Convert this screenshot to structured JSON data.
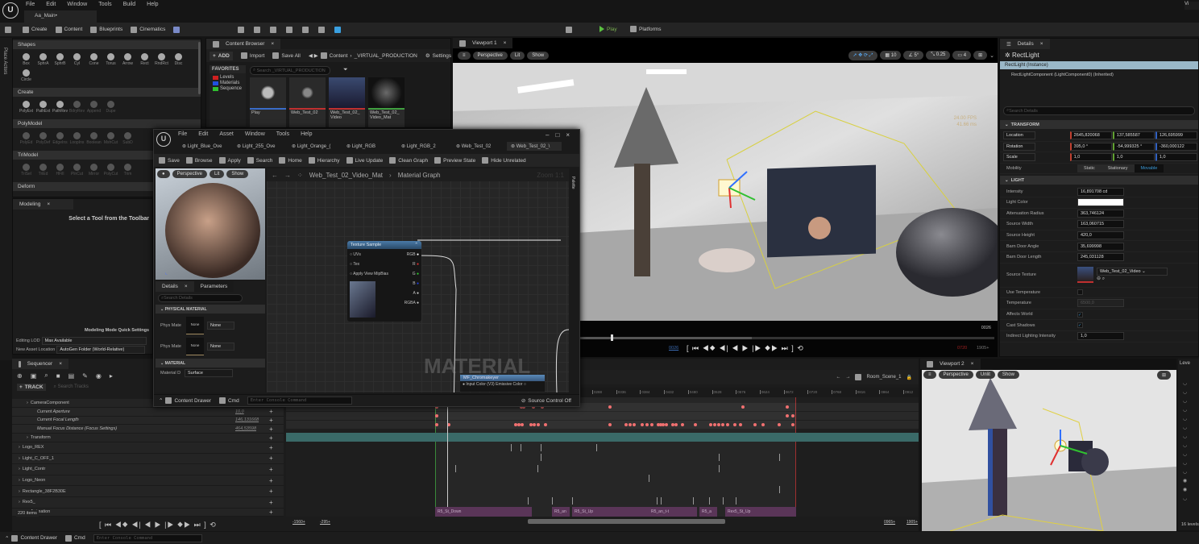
{
  "app": {
    "menu": [
      "File",
      "Edit",
      "Window",
      "Tools",
      "Build",
      "Help"
    ],
    "level_tab": "Aa_Main•",
    "top_right": "Vi"
  },
  "toolbar": {
    "create": "Create",
    "content": "Content",
    "blueprints": "Blueprints",
    "cinematics": "Cinematics",
    "play": "Play",
    "platforms": "Platforms"
  },
  "place_actors": {
    "side_label": "Place Actors",
    "sections": [
      {
        "title": "Shapes",
        "items": [
          "Box",
          "SphrA",
          "SphrB",
          "Cyl",
          "Cone",
          "Torus",
          "Arrow",
          "Rect",
          "RndRct",
          "Disc",
          "Circle"
        ]
      },
      {
        "title": "Create",
        "items": [
          "PolyExt",
          "PathExt",
          "PathRev",
          "BdryRev",
          "Append",
          "Dupe"
        ]
      },
      {
        "title": "PolyModel",
        "items": [
          "PolyEd",
          "PolyDef",
          "EdgeIns",
          "LoopIns",
          "Boolean",
          "MshCut",
          "SubD"
        ]
      },
      {
        "title": "TriModel",
        "items": [
          "TriSel",
          "TriEd",
          "HFill",
          "PlnCut",
          "Mirror",
          "PolyCut",
          "Trim"
        ]
      },
      {
        "title": "Deform",
        "items": []
      }
    ]
  },
  "modeling": {
    "tab": "Modeling",
    "hint": "Select a Tool from the Toolbar",
    "quick_settings": "Modeling Mode Quick Settings",
    "editing_lod_label": "Editing LOD",
    "editing_lod_value": "Max Available",
    "asset_loc_label": "New Asset Location",
    "asset_loc_value": "AutoGen Folder (World-Relative)"
  },
  "content_browser": {
    "tab": "Content Browser",
    "add": "ADD",
    "import": "Import",
    "save_all": "Save All",
    "path": [
      "Content",
      "_VIRTUAL_PRODUCTION"
    ],
    "settings": "Settings",
    "favorites": "FAVORITES",
    "search_placeholder": "Search _VIRTUAL_PRODUCTION",
    "folders": [
      {
        "name": "Levels",
        "color": "#d02020"
      },
      {
        "name": "Materials",
        "color": "#2050e0"
      },
      {
        "name": "Sequence",
        "color": "#30c030"
      }
    ],
    "assets": [
      {
        "name": "Play",
        "bar": "#3a6cc8"
      },
      {
        "name": "Web_Test_02",
        "bar": "#c03030"
      },
      {
        "name": "Web_Test_02_ Video",
        "bar": "#c03030"
      },
      {
        "name": "Web_Test_02_ Video_Mat",
        "bar": "#40a040"
      }
    ]
  },
  "material_editor": {
    "menu": [
      "File",
      "Edit",
      "Asset",
      "Window",
      "Tools",
      "Help"
    ],
    "tabs": [
      "Light_Blue_Ove",
      "Light_255_Ove",
      "Light_Orange_(",
      "Light_RGB",
      "Light_RGB_2",
      "Web_Test_02",
      "Web_Test_02_\\"
    ],
    "toolbar": [
      "Save",
      "Browse",
      "Apply",
      "Search",
      "Home",
      "Hierarchy",
      "Live Update",
      "Clean Graph",
      "Preview State",
      "Hide Unrelated"
    ],
    "preview": {
      "perspective": "Perspective",
      "lit": "Lit",
      "show": "Show"
    },
    "breadcrumb": [
      "Web_Test_02_Video_Mat",
      "Material Graph"
    ],
    "zoom": "Zoom 1:1",
    "palette": "Palette",
    "details_tab": "Details",
    "parameters_tab": "Parameters",
    "search_placeholder": "Search Details",
    "physical_material": "PHYSICAL MATERIAL",
    "phys_rows": [
      {
        "label": "Phys Mate",
        "thumb": "None",
        "value": "None"
      },
      {
        "label": "Phys Mate",
        "thumb": "None",
        "value": "None"
      }
    ],
    "material_section": "MATERIAL",
    "material_domain_label": "Material D",
    "material_domain_value": "Surface",
    "node": {
      "title": "Texture Sample",
      "inputs": [
        "UVs",
        "Tex",
        "Apply View MipBias"
      ],
      "outputs": [
        {
          "name": "RGB",
          "color": "#ffffff"
        },
        {
          "name": "R",
          "color": "#e03030"
        },
        {
          "name": "G",
          "color": "#30d030"
        },
        {
          "name": "B",
          "color": "#2040e0"
        },
        {
          "name": "A",
          "color": "#cccccc"
        },
        {
          "name": "RGBA",
          "color": "#cccccc"
        }
      ]
    },
    "node2": {
      "title": "MF_Chromakeyer",
      "input": "Input Color (V3)",
      "output": "Emissive Color"
    },
    "watermark": "MATERIAL",
    "content_drawer": "Content Drawer",
    "cmd": "Cmd",
    "console_placeholder": "Enter Console Command",
    "source_control": "Source Control Off"
  },
  "viewport1": {
    "tab": "Viewport 1",
    "perspective": "Perspective",
    "lit": "Lit",
    "show": "Show",
    "grid": "10",
    "angle": "5°",
    "scale": "0.25",
    "camera_speed": "4",
    "fps": "24.00 FPS",
    "ms": "41.66 ms",
    "frame_right": "0026",
    "frame_current": "0026",
    "frame_end": "0720",
    "frame_max": "1905+",
    "playhead_fraction": 0.29,
    "range_fraction": 0.55
  },
  "details": {
    "tab": "Details",
    "actor": "RectLight",
    "instance": "RectLight  (Instance)",
    "component": "RectLightComponent (LightComponent0) (Inherited)",
    "search_placeholder": "Search Details",
    "transform": "TRANSFORM",
    "location": {
      "label": "Location",
      "x": "2645,820068",
      "y": "137,585587",
      "z": "126,695999"
    },
    "rotation": {
      "label": "Rotation",
      "x": "395,0 °",
      "y": "-54,999325 °",
      "z": "-360,000122"
    },
    "scale": {
      "label": "Scale",
      "x": "1,0",
      "y": "1,0",
      "z": "1,0"
    },
    "mobility": {
      "label": "Mobility",
      "options": [
        "Static",
        "Stationary",
        "Movable"
      ],
      "selected": "Movable"
    },
    "light": "LIGHT",
    "props": [
      {
        "label": "Intensity",
        "value": "16,891708 cd"
      },
      {
        "label": "Light Color",
        "value": ""
      },
      {
        "label": "Attenuation Radius",
        "value": "363,746124"
      },
      {
        "label": "Source Width",
        "value": "163,060715"
      },
      {
        "label": "Source Height",
        "value": "420,0"
      },
      {
        "label": "Barn Door Angle",
        "value": "35,699998"
      },
      {
        "label": "Barn Door Length",
        "value": "245,031128"
      }
    ],
    "source_texture_label": "Source Texture",
    "source_texture_value": "Web_Test_02_Video",
    "checks": [
      {
        "label": "Use Temperature",
        "checked": false
      },
      {
        "label": "Temperature",
        "value": "6500,0"
      },
      {
        "label": "Affects World",
        "checked": true
      },
      {
        "label": "Cast Shadows",
        "checked": true
      },
      {
        "label": "Indirect Lighting Intensity",
        "value": "1,0"
      }
    ]
  },
  "sequencer": {
    "tab": "Sequencer",
    "track_button": "TRACK",
    "search_placeholder": "Search Tracks",
    "sequence_name": "Room_Scene_1",
    "tracks": [
      {
        "name": "CameraComponent",
        "level": 1
      },
      {
        "name": "Current Aperture",
        "value": "10,0",
        "level": 2
      },
      {
        "name": "Current Focal Length",
        "value": "146,131668",
        "level": 2
      },
      {
        "name": "Manual Focus Distance (Focus Settings)",
        "value": "464,53598",
        "level": 2
      },
      {
        "name": "Transform",
        "level": 1
      },
      {
        "name": "Logo_REX",
        "level": 0
      },
      {
        "name": "Light_C_OFF_1",
        "level": 0
      },
      {
        "name": "Light_Contr",
        "level": 0
      },
      {
        "name": "Logo_Neon",
        "level": 0
      },
      {
        "name": "Rectangle_38F2B30E",
        "level": 0
      },
      {
        "name": "Rex5_",
        "level": 0
      },
      {
        "name": "Animation",
        "level": 1
      }
    ],
    "item_count": "220 items",
    "ruler": [
      "0288",
      "0336",
      "0384",
      "0432",
      "0480",
      "0528",
      "0576",
      "0624",
      "0672",
      "0720",
      "0768",
      "0816",
      "0864",
      "0912"
    ],
    "range_start": "-1560+",
    "range_start2": "-295+",
    "range_end": "0965+",
    "range_end2": "1905+",
    "clips": [
      "R5_St_Down",
      "R5_an",
      "R5_St_Up",
      "R5_an_t-t",
      "R5_a",
      "Rex5_St_Up"
    ]
  },
  "viewport2": {
    "tab": "Viewport 2",
    "perspective": "Perspective",
    "unlit": "Unlit",
    "show": "Show"
  },
  "levels": {
    "tab": "Leve",
    "count": "16 levels"
  },
  "status": {
    "content_drawer": "Content Drawer",
    "cmd": "Cmd",
    "console_placeholder": "Enter Console Command"
  },
  "colors": {
    "accent": "#3a8ad8",
    "selection": "#9ab8c8",
    "keyframe": "#f07070",
    "clip": "#6a3a6a"
  }
}
